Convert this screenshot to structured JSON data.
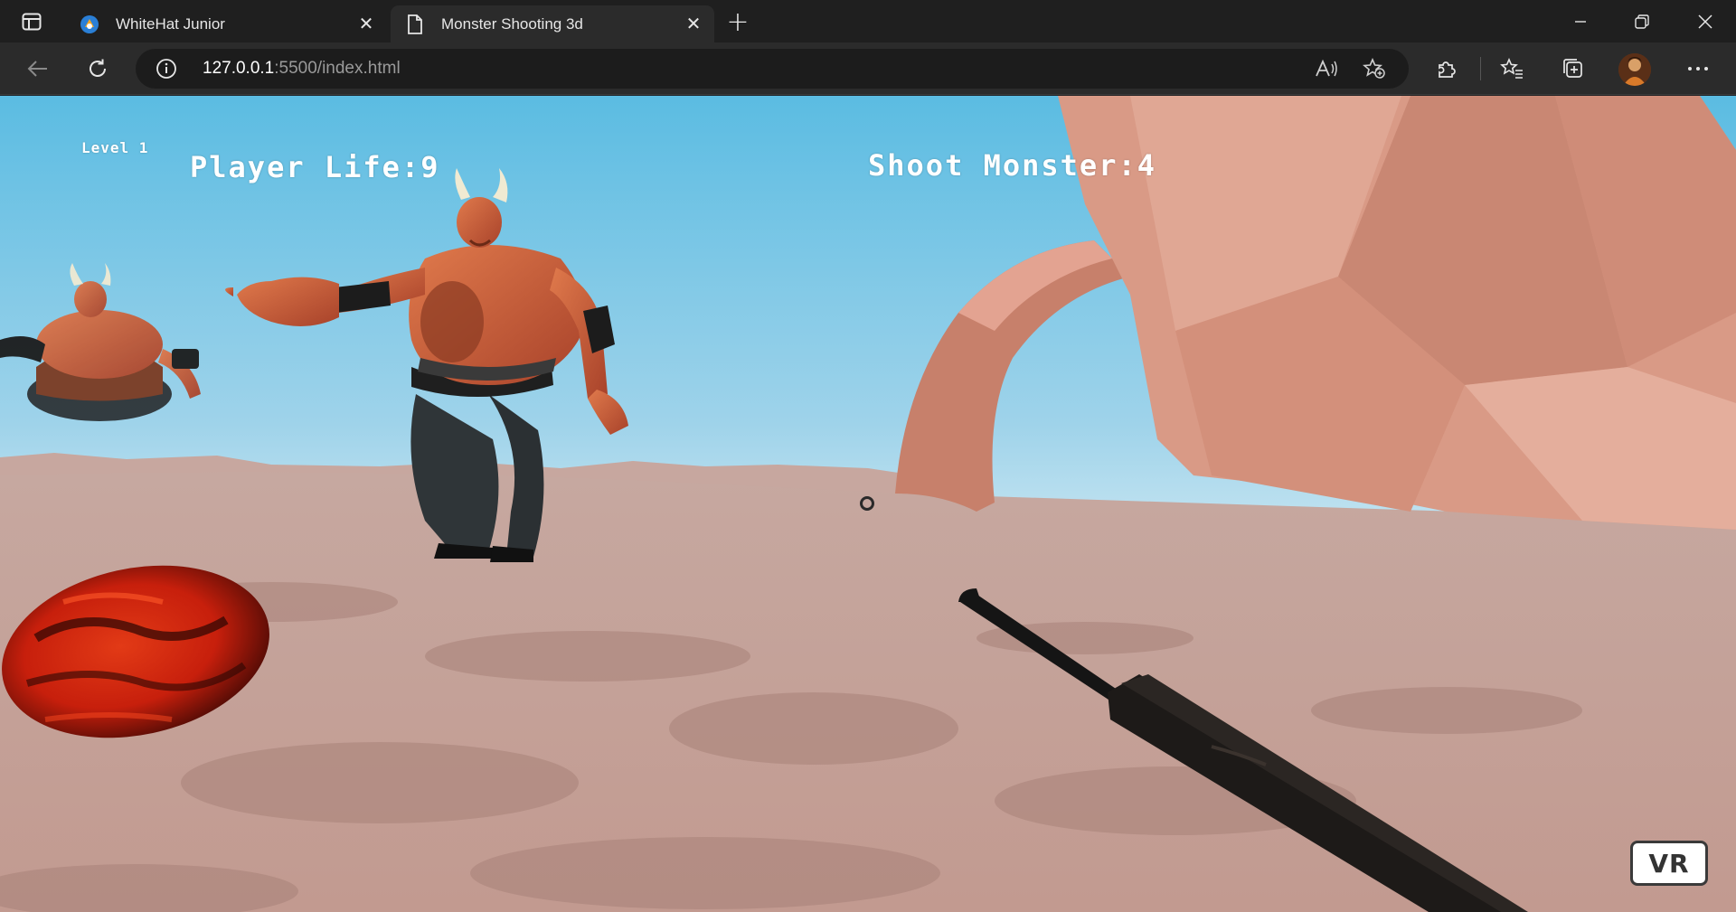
{
  "tabs": [
    {
      "title": "WhiteHat Junior",
      "favicon": "whitehat-favicon-icon",
      "active": false
    },
    {
      "title": "Monster Shooting 3d",
      "favicon": "page-icon",
      "active": true
    }
  ],
  "toolbar": {
    "url_host": "127.0.0.1",
    "url_rest": ":5500/index.html"
  },
  "hud": {
    "level": "Level 1",
    "player_life": "Player Life:9",
    "shoot_monster": "Shoot Monster:4"
  },
  "vr_button": "VR",
  "colors": {
    "sky_top": "#5bbce2",
    "sky_bottom": "#cfe9f3",
    "ground": "#c8a49b",
    "rock": "#d99a86",
    "monster_skin": "#d2643c",
    "lava": "#d42a10",
    "chrome_dark": "#1f1f1f",
    "chrome_toolbar": "#2b2b2b"
  }
}
